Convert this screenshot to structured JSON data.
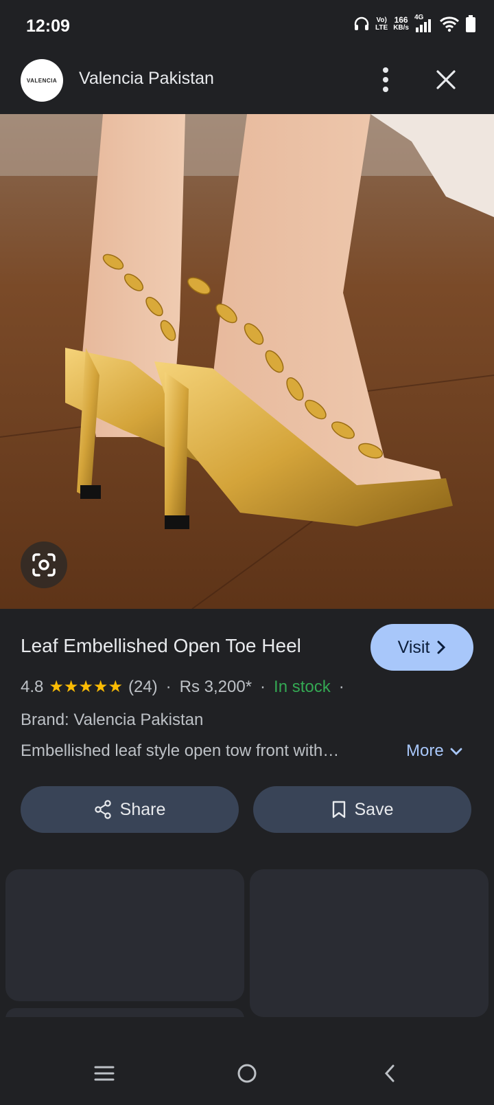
{
  "status_bar": {
    "time": "12:09",
    "volte_top": "Vo)",
    "volte_bottom": "LTE",
    "speed_value": "166",
    "speed_unit": "KB/s",
    "network": "4G",
    "icons": [
      "headphones-icon",
      "signal-icon",
      "wifi-icon",
      "battery-icon"
    ]
  },
  "header": {
    "logo_text": "VALENCIA",
    "site_name": "Valencia Pakistan",
    "icons": [
      "more-vert-icon",
      "close-icon"
    ]
  },
  "product": {
    "image_alt": "Gold leaf embellished open toe high heels",
    "title": "Leaf Embellished Open Toe Heel",
    "visit_label": "Visit",
    "rating": "4.8",
    "stars": 5,
    "review_count": "(24)",
    "price": "Rs 3,200*",
    "stock": "In stock",
    "brand": "Brand: Valencia Pakistan",
    "description": "Embellished leaf style open tow front with…",
    "more_label": "More"
  },
  "actions": {
    "share_label": "Share",
    "save_label": "Save"
  },
  "colors": {
    "background": "#202124",
    "accent": "#a8c7fa",
    "stock_green": "#34a853",
    "star_yellow": "#fbbc04",
    "pill_bg": "#394457"
  }
}
